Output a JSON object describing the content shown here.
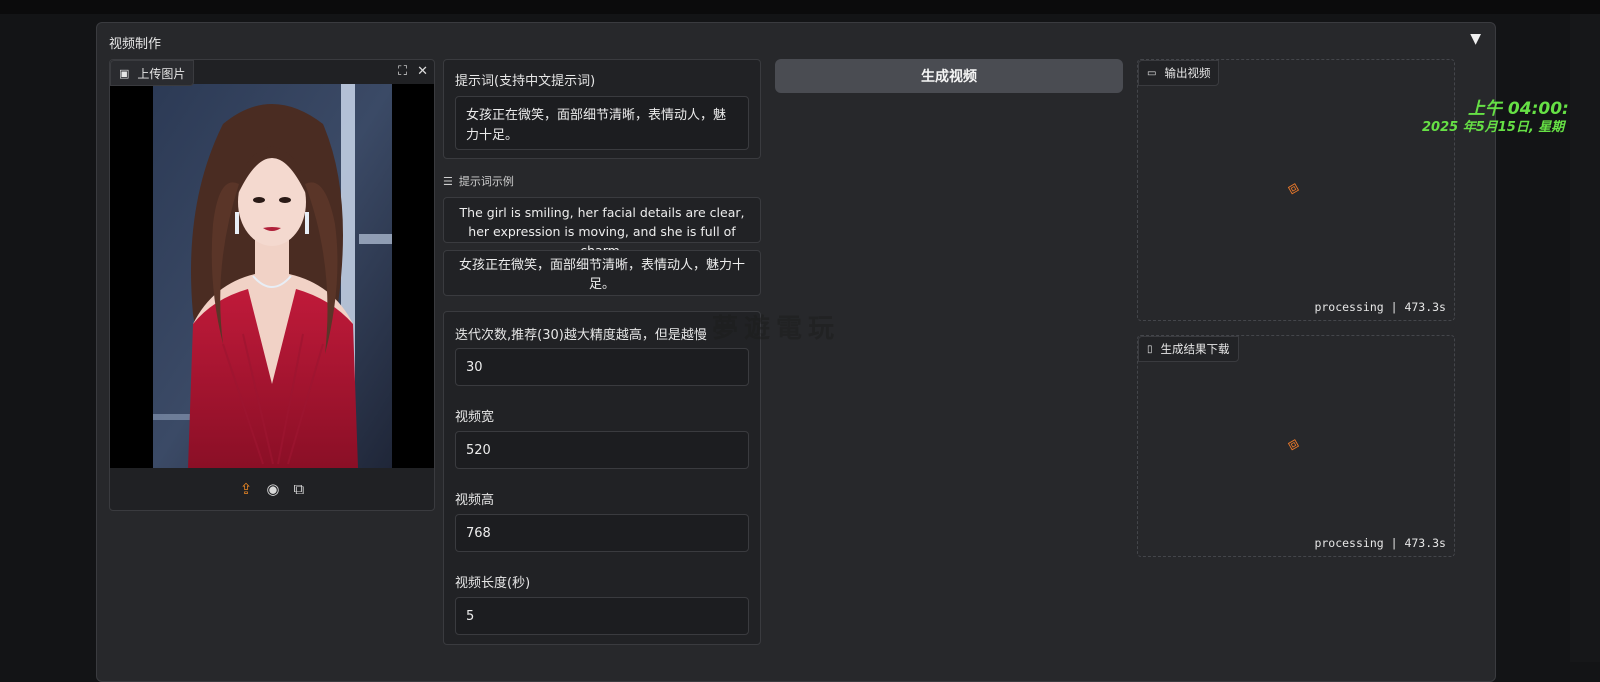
{
  "section": {
    "title": "视频制作",
    "collapse_arrow": "▼"
  },
  "image_panel": {
    "label": "上传图片",
    "icons": [
      "image-icon",
      "fullscreen-icon",
      "close-icon",
      "upload-icon",
      "webcam-icon",
      "clipboard-icon"
    ]
  },
  "prompt": {
    "label": "提示词(支持中文提示词)",
    "value": "女孩正在微笑，面部细节清晰，表情动人，魅力十足。"
  },
  "examples": {
    "label": "提示词示例",
    "items": [
      "The girl is smiling, her facial details are clear, her expression is moving, and she is full of charm.",
      "女孩正在微笑，面部细节清晰，表情动人，魅力十足。"
    ]
  },
  "params": {
    "steps": {
      "label": "迭代次数,推荐(30)越大精度越高，但是越慢",
      "value": "30"
    },
    "width": {
      "label": "视频宽",
      "value": "520"
    },
    "height": {
      "label": "视频高",
      "value": "768"
    },
    "duration": {
      "label": "视频长度(秒)",
      "value": "5"
    }
  },
  "generate_button": {
    "label": "生成视频"
  },
  "output_video": {
    "label": "输出视频",
    "status": "processing | 473.3s"
  },
  "download": {
    "label": "生成结果下载",
    "status": "processing | 473.3s"
  },
  "watermark": "夢遊電玩",
  "clock": {
    "time": "上午 04:00:",
    "date": "2025 年5月15日, 星期"
  },
  "colors": {
    "accent": "#f08a24",
    "clock": "#66e045",
    "panel": "#27282b"
  }
}
